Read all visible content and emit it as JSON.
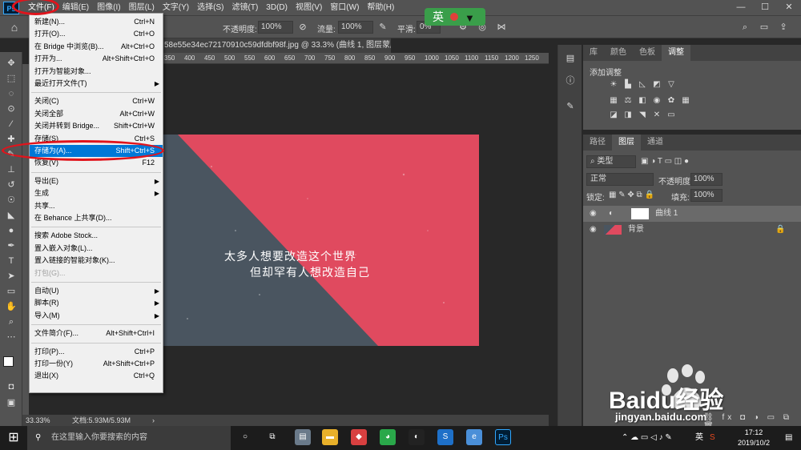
{
  "menubar": {
    "logo": "Ps",
    "items": [
      "文件(F)",
      "编辑(E)",
      "图像(I)",
      "图层(L)",
      "文字(Y)",
      "选择(S)",
      "滤镜(T)",
      "3D(D)",
      "视图(V)",
      "窗口(W)",
      "帮助(H)"
    ],
    "window_controls": [
      "—",
      "☐",
      "✕"
    ]
  },
  "options": {
    "opacity_label": "不透明度:",
    "opacity_value": "100%",
    "flow_label": "流量:",
    "flow_value": "100%",
    "smooth_label": "平滑:",
    "smooth_value": "0%",
    "ime_label": "英"
  },
  "document": {
    "tab_title": "58e55e34ec72170910c59dfdbf98f.jpg @ 33.3% (曲线 1, 图层蒙版/8) *",
    "ruler_ticks": [
      "350",
      "400",
      "450",
      "500",
      "550",
      "600",
      "650",
      "700",
      "750",
      "800",
      "850",
      "900",
      "950",
      "1000",
      "1050",
      "1100",
      "1150",
      "1200",
      "1250"
    ],
    "zoom": "33.33%",
    "doc_size": "文档:5.93M/5.93M",
    "art_line1": "太多人想要改造这个世界",
    "art_line2": "但却罕有人想改造自己",
    "art_colors": {
      "slate": "#4a5560",
      "pink": "#e04a5f"
    }
  },
  "file_menu": {
    "items": [
      {
        "label": "新建(N)...",
        "shortcut": "Ctrl+N"
      },
      {
        "label": "打开(O)...",
        "shortcut": "Ctrl+O"
      },
      {
        "label": "在 Bridge 中浏览(B)...",
        "shortcut": "Alt+Ctrl+O"
      },
      {
        "label": "打开为...",
        "shortcut": "Alt+Shift+Ctrl+O"
      },
      {
        "label": "打开为智能对象...",
        "shortcut": ""
      },
      {
        "label": "最近打开文件(T)",
        "shortcut": "",
        "submenu": true
      },
      {
        "label": "关闭(C)",
        "shortcut": "Ctrl+W"
      },
      {
        "label": "关闭全部",
        "shortcut": "Alt+Ctrl+W"
      },
      {
        "label": "关闭并转到 Bridge...",
        "shortcut": "Shift+Ctrl+W"
      },
      {
        "label": "存储(S)",
        "shortcut": "Ctrl+S"
      },
      {
        "label": "存储为(A)...",
        "shortcut": "Shift+Ctrl+S",
        "highlighted": true
      },
      {
        "label": "恢复(V)",
        "shortcut": "F12"
      },
      {
        "label": "导出(E)",
        "shortcut": "",
        "submenu": true
      },
      {
        "label": "生成",
        "shortcut": "",
        "submenu": true
      },
      {
        "label": "共享...",
        "shortcut": ""
      },
      {
        "label": "在 Behance 上共享(D)...",
        "shortcut": ""
      },
      {
        "label": "搜索 Adobe Stock...",
        "shortcut": ""
      },
      {
        "label": "置入嵌入对象(L)...",
        "shortcut": ""
      },
      {
        "label": "置入链接的智能对象(K)...",
        "shortcut": ""
      },
      {
        "label": "打包(G)...",
        "shortcut": "",
        "disabled": true
      },
      {
        "label": "自动(U)",
        "shortcut": "",
        "submenu": true
      },
      {
        "label": "脚本(R)",
        "shortcut": "",
        "submenu": true
      },
      {
        "label": "导入(M)",
        "shortcut": "",
        "submenu": true
      },
      {
        "label": "文件简介(F)...",
        "shortcut": "Alt+Shift+Ctrl+I"
      },
      {
        "label": "打印(P)...",
        "shortcut": "Ctrl+P"
      },
      {
        "label": "打印一份(Y)",
        "shortcut": "Alt+Shift+Ctrl+P"
      },
      {
        "label": "退出(X)",
        "shortcut": "Ctrl+Q"
      }
    ]
  },
  "adjust_panel": {
    "tabs": [
      "库",
      "颜色",
      "色板",
      "调整"
    ],
    "active_tab": "调整",
    "title": "添加调整"
  },
  "layers_panel": {
    "tabs": [
      "路径",
      "图层",
      "通道"
    ],
    "active_tab": "图层",
    "filter": "类型",
    "blend_mode": "正常",
    "opacity_label": "不透明度:",
    "opacity_value": "100%",
    "lock_label": "锁定:",
    "fill_label": "填充:",
    "fill_value": "100%",
    "layers": [
      {
        "name": "曲线 1",
        "selected": true
      },
      {
        "name": "背景",
        "selected": false
      }
    ]
  },
  "taskbar": {
    "search_placeholder": "在这里输入你要搜索的内容",
    "ime": "英",
    "time": "17:12",
    "date": "2019/10/2"
  },
  "watermark": {
    "brand": "Baidu经验",
    "url": "jingyan.baidu.com"
  }
}
